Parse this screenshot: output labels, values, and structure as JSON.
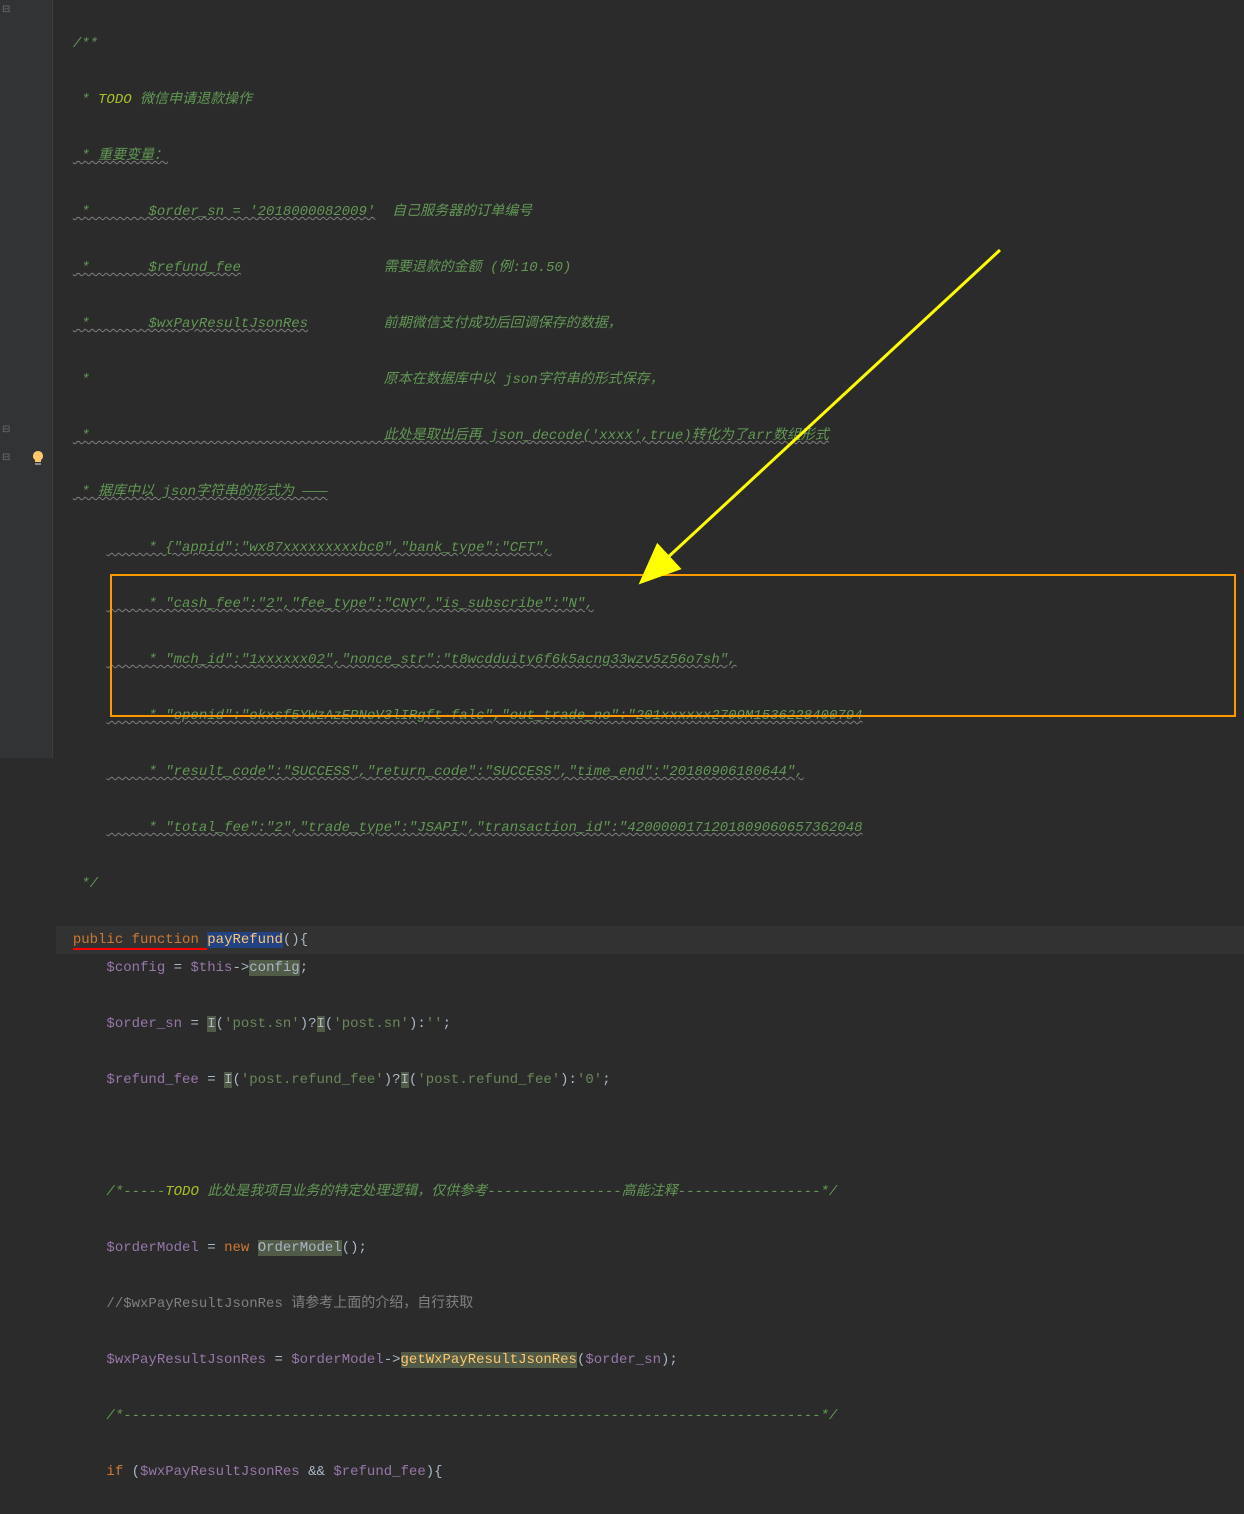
{
  "lines": {
    "l0": "/**",
    "l1": " * TODO 微信申请退款操作",
    "l1_todo": "TODO",
    "l1_rest": " 微信申请退款操作",
    "l2": " * 重要变量：",
    "l3_a": " *       $order_sn = '2018000082009'",
    "l3_b": "  自己服务器的订单编号",
    "l4_a": " *       $refund_fee",
    "l4_b": "                 需要退款的金额 (例:10.50)",
    "l5_a": " *       $wxPayResultJsonRes",
    "l5_b": "         前期微信支付成功后回调保存的数据，",
    "l6": " *                                   原本在数据库中以 json字符串的形式保存，",
    "l7": " *                                   此处是取出后再 json_decode('xxxx',true)转化为了arr数组形式",
    "l8": " * 据库中以 json字符串的形式为 ———",
    "l9": "     * {\"appid\":\"wx87xxxxxxxxxbc0\",\"bank_type\":\"CFT\",",
    "l10": "     * \"cash_fee\":\"2\",\"fee_type\":\"CNY\",\"is_subscribe\":\"N\",",
    "l11": "     * \"mch_id\":\"1xxxxxx02\",\"nonce_str\":\"t8wcdduity6f6k5acng33wzv5z56o7sh\",",
    "l12": "     * \"openid\":\"okxsf5YWzAzEPNoV3lIRgft-falc\",\"out_trade_no\":\"201xxxxxx2709M1536228400794",
    "l13": "     * \"result_code\":\"SUCCESS\",\"return_code\":\"SUCCESS\",\"time_end\":\"20180906180644\",",
    "l14": "     * \"total_fee\":\"2\",\"trade_type\":\"JSAPI\",\"transaction_id\":\"4200000171201809060657362048",
    "l15": " */",
    "fn_public": "public",
    "fn_function": "function",
    "fn_name": "payRefund",
    "config_var": "$config",
    "this_kw": "$this",
    "config_prop": "config",
    "order_sn_var": "$order_sn",
    "I_fn": "I",
    "post_sn": "'post.sn'",
    "empty_str": "''",
    "refund_fee_var": "$refund_fee",
    "post_refund_fee": "'post.refund_fee'",
    "zero_str": "'0'",
    "todo2_a": "/*-----",
    "todo2_todo": "TODO",
    "todo2_b": " 此处是我项目业务的特定处理逻辑，仅供参考----------------高能注释-----------------*/",
    "orderModel_var": "$orderModel",
    "new_kw": "new",
    "OrderModel": "OrderModel",
    "comment_wx": "//$wxPayResultJsonRes 请参考上面的介绍，自行获取",
    "wxPayRes_var": "$wxPayResultJsonRes",
    "getWx": "getWxPayResultJsonRes",
    "sep_line": "/*-----------------------------------------------------------------------------------*/",
    "if_kw": "if",
    "amp": "&&"
  }
}
